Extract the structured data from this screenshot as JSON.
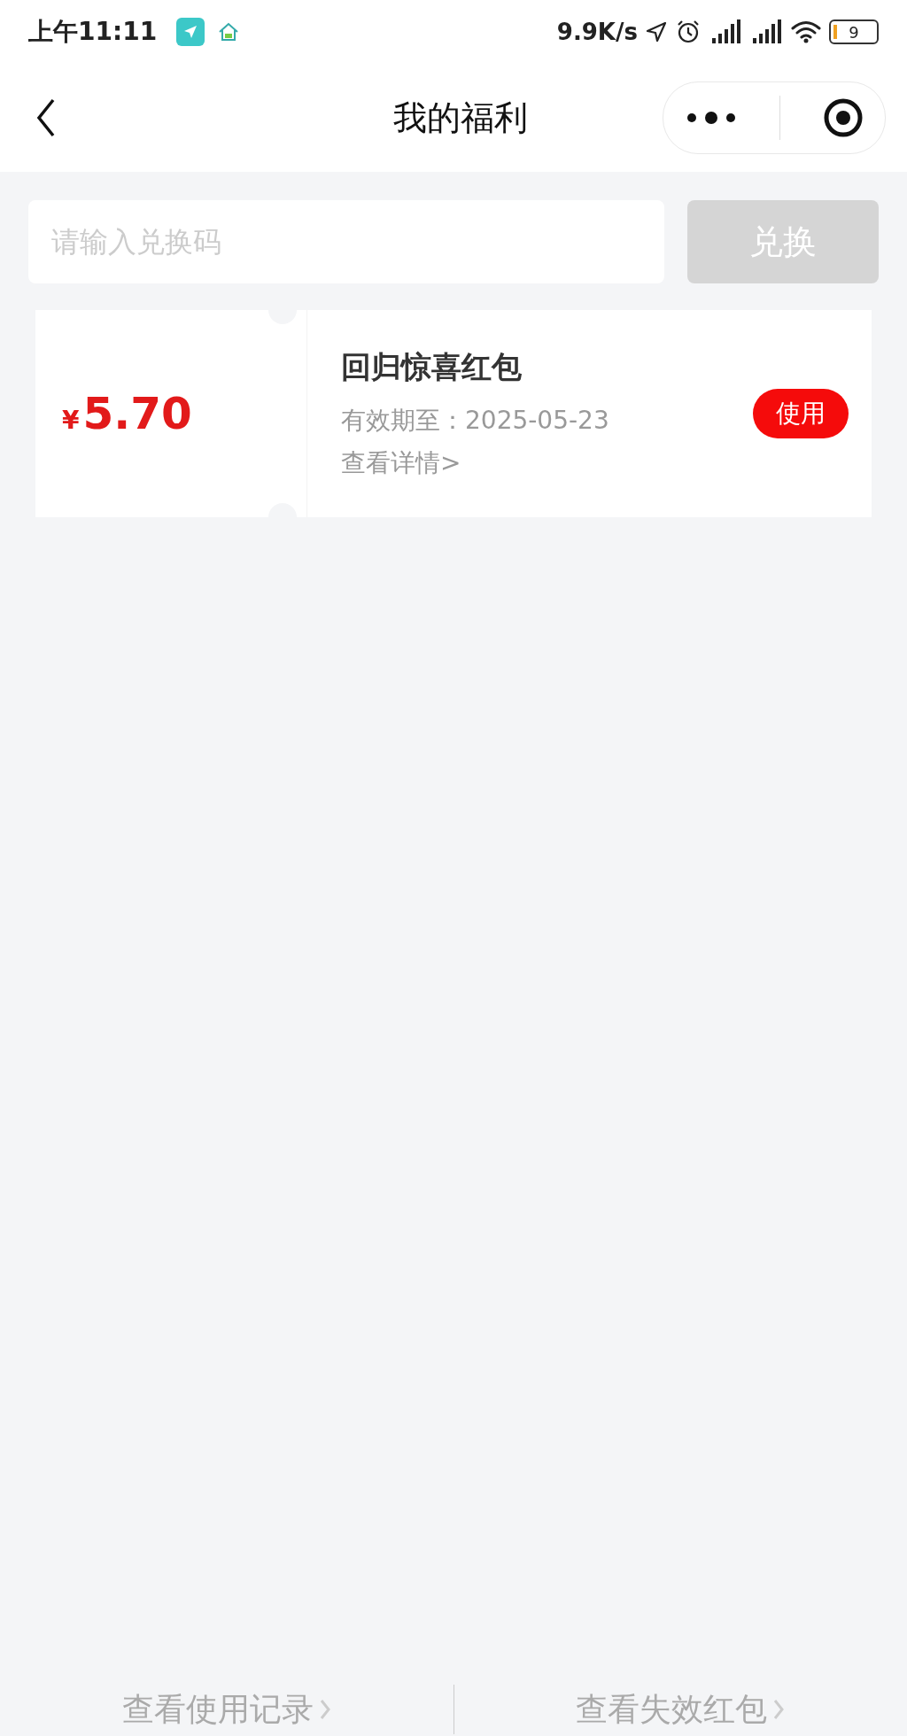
{
  "status_bar": {
    "time": "上午11:11",
    "network_speed": "9.9K/s",
    "battery": "9"
  },
  "nav_bar": {
    "title": "我的福利"
  },
  "redeem": {
    "placeholder": "请输入兑换码",
    "button": "兑换",
    "disabled": true
  },
  "coupons": [
    {
      "currency": "¥",
      "amount": "5.70",
      "name": "回归惊喜红包",
      "validity": "有效期至：2025-05-23",
      "details_link": "查看详情>",
      "action": "使用"
    }
  ],
  "footer_links": [
    "查看使用记录",
    "查看失效红包"
  ]
}
